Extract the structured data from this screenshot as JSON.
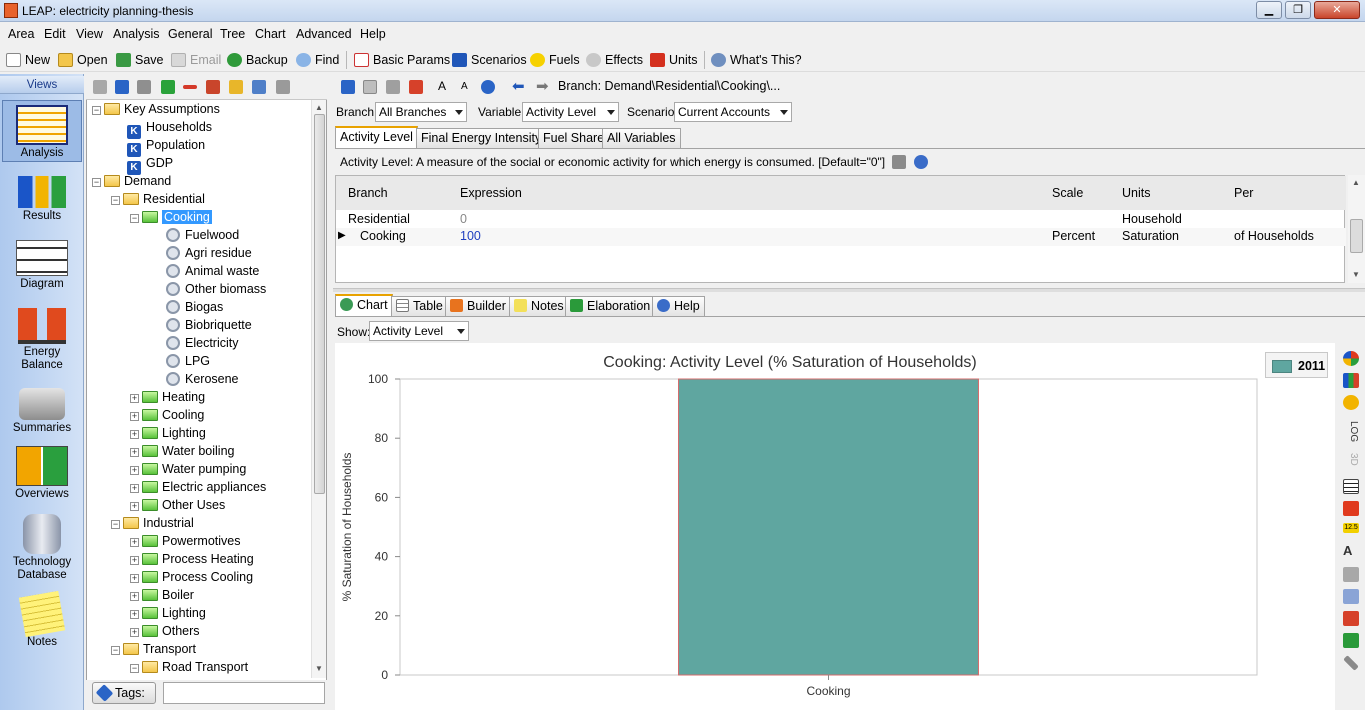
{
  "window": {
    "title": "LEAP: electricity planning-thesis",
    "minimize": "▁",
    "maximize": "❐",
    "close": "✕"
  },
  "menu": [
    "Area",
    "Edit",
    "View",
    "Analysis",
    "General",
    "Tree",
    "Chart",
    "Advanced",
    "Help"
  ],
  "toolbar": {
    "new": "New",
    "open": "Open",
    "save": "Save",
    "email": "Email",
    "backup": "Backup",
    "find": "Find",
    "basic_params": "Basic Params",
    "scenarios": "Scenarios",
    "fuels": "Fuels",
    "effects": "Effects",
    "units": "Units",
    "whats_this": "What's This?"
  },
  "views": {
    "header": "Views",
    "items": [
      "Analysis",
      "Results",
      "Diagram",
      "Energy Balance",
      "Summaries",
      "Overviews",
      "Technology Database",
      "Notes"
    ]
  },
  "tree": {
    "key_assumptions": "Key Assumptions",
    "households": "Households",
    "population": "Population",
    "gdp": "GDP",
    "demand": "Demand",
    "residential": "Residential",
    "cooking": "Cooking",
    "fuelwood": "Fuelwood",
    "agri_residue": "Agri residue",
    "animal_waste": "Animal waste",
    "other_biomass": "Other biomass",
    "biogas": "Biogas",
    "biobriquette": "Biobriquette",
    "electricity": "Electricity",
    "lpg": "LPG",
    "kerosene": "Kerosene",
    "heating": "Heating",
    "cooling": "Cooling",
    "lighting": "Lighting",
    "water_boiling": "Water boiling",
    "water_pumping": "Water pumping",
    "electric_appliances": "Electric appliances",
    "other_uses": "Other Uses",
    "industrial": "Industrial",
    "powermotives": "Powermotives",
    "process_heating": "Process Heating",
    "process_cooling": "Process Cooling",
    "boiler": "Boiler",
    "ind_lighting": "Lighting",
    "others": "Others",
    "transport": "Transport",
    "road_transport": "Road Transport",
    "k_label": "K"
  },
  "tags": {
    "label": "Tags:",
    "value": ""
  },
  "branch_path": {
    "label": "Branch: Demand\\Residential\\Cooking\\..."
  },
  "selectors": {
    "branch_label": "Branch:",
    "branch_value": "All Branches",
    "variable_label": "Variable:",
    "variable_value": "Activity Level",
    "scenario_label": "Scenario:",
    "scenario_value": "Current Accounts"
  },
  "var_tabs": [
    "Activity Level",
    "Final Energy Intensity",
    "Fuel Share",
    "All Variables"
  ],
  "description": "Activity Level: A measure of the social or economic activity for which energy is consumed. [Default=\"0\"]",
  "grid": {
    "headers": [
      "Branch",
      "Expression",
      "Scale",
      "Units",
      "Per"
    ],
    "rows": [
      {
        "branch": "Residential",
        "expression": "0",
        "scale": "",
        "units": "Household",
        "per": ""
      },
      {
        "branch": "Cooking",
        "expression": "100",
        "scale": "Percent",
        "units": "Saturation",
        "per": "of Households"
      }
    ]
  },
  "bottom_tabs": [
    "Chart",
    "Table",
    "Builder",
    "Notes",
    "Elaboration",
    "Help"
  ],
  "show": {
    "label": "Show:",
    "value": "Activity Level"
  },
  "chart_tools": {
    "log": "LOG",
    "three_d": "3D",
    "value_badge": "12.5"
  },
  "chart_data": {
    "type": "bar",
    "title": "Cooking: Activity Level (% Saturation of Households)",
    "categories": [
      "Cooking"
    ],
    "series": [
      {
        "name": "2011",
        "values": [
          100
        ],
        "color": "#5fa6a0"
      }
    ],
    "xlabel": "",
    "ylabel": "% Saturation of Households",
    "ylim": [
      0,
      100
    ],
    "yticks": [
      0,
      20,
      40,
      60,
      80,
      100
    ],
    "grid": false,
    "legend": "top-right"
  }
}
